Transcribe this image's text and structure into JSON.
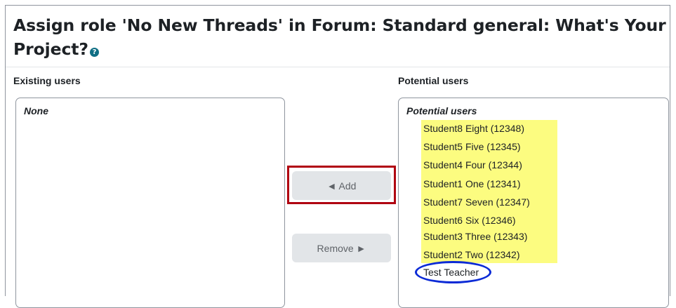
{
  "page": {
    "title": "Assign role 'No New Threads' in Forum: Standard general: What's Your Project?",
    "help_icon": "question-circle-icon"
  },
  "existing": {
    "label": "Existing users",
    "group_label": "None"
  },
  "potential": {
    "label": "Potential users",
    "group_label": "Potential users",
    "options": [
      "Student8 Eight (12348)",
      "Student5 Five (12345)",
      "Student4 Four (12344)",
      "Student1 One (12341)",
      "Student7 Seven (12347)",
      "Student6 Six (12346)",
      "Student3 Three (12343)",
      "Student2 Two (12342)",
      "Test Teacher"
    ]
  },
  "buttons": {
    "add_label": "◄ Add",
    "remove_label": "Remove ►"
  },
  "colors": {
    "highlight": "#fcfc80",
    "annotation_box": "#b00010",
    "annotation_ellipse": "#0b2ad6",
    "help_icon": "#0f6e84"
  }
}
